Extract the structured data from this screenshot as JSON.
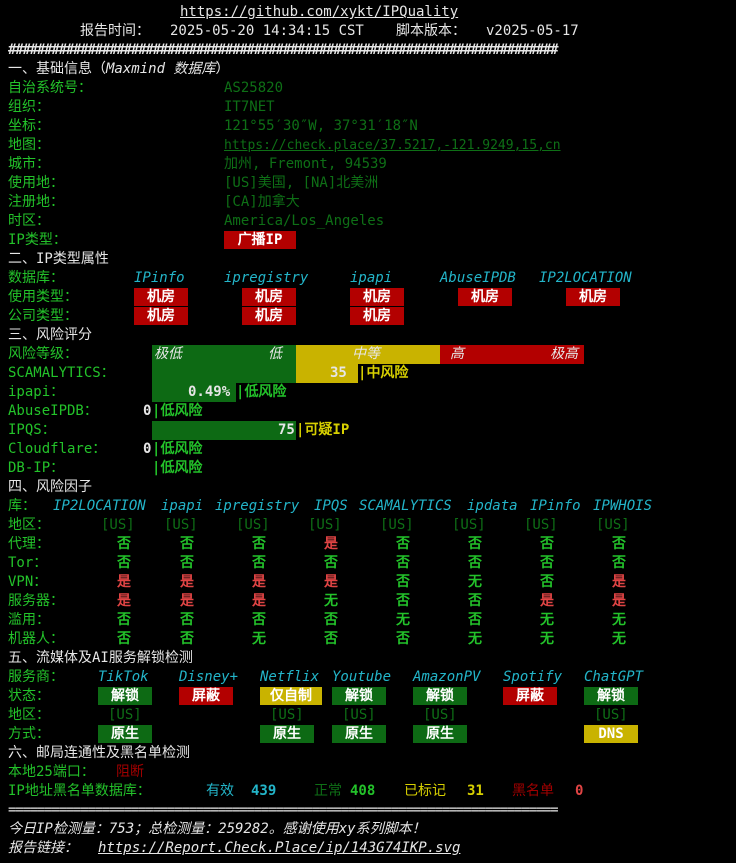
{
  "header": {
    "url": "https://github.com/xykt/IPQuality",
    "report_time_label": "报告时间：",
    "report_time": "2025-05-20 14:34:15 CST",
    "script_version_label": "脚本版本：",
    "script_version": "v2025-05-17",
    "separator": "############################################################################"
  },
  "basic": {
    "title": "一、基础信息（",
    "title_source": "Maxmind 数据库",
    "title_end": "）",
    "asn_label": "自治系统号：",
    "asn": "AS25820",
    "org_label": "组织：",
    "org": "IT7NET",
    "coord_label": "坐标：",
    "coord": "121°55′30″W, 37°31′18″N",
    "map_label": "地图：",
    "map": "https://check.place/37.5217,-121.9249,15,cn",
    "city_label": "城市：",
    "city": "加州, Fremont, 94539",
    "usage_loc_label": "使用地：",
    "usage_loc": "[US]美国, [NA]北美洲",
    "reg_loc_label": "注册地：",
    "reg_loc": "[CA]加拿大",
    "tz_label": "时区：",
    "tz": "America/Los_Angeles",
    "iptype_label": "IP类型：",
    "iptype": "广播IP"
  },
  "iptype": {
    "title": "二、IP类型属性",
    "db_label": "数据库：",
    "dbs": [
      "IPinfo",
      "ipregistry",
      "ipapi",
      "AbuseIPDB",
      "IP2LOCATION"
    ],
    "usage_label": "使用类型：",
    "usage": [
      "机房",
      "机房",
      "机房",
      "机房",
      "机房"
    ],
    "company_label": "公司类型：",
    "company": [
      "机房",
      "机房",
      "机房"
    ]
  },
  "risk": {
    "title": "三、风险评分",
    "level_label": "风险等级：",
    "levels": [
      "极低",
      "低",
      "中等",
      "高",
      "极高"
    ],
    "scam_label": "SCAMALYTICS：",
    "scam_score": "35",
    "scam_text": "中风险",
    "scam_pct": 35,
    "ipapi_label": "ipapi：",
    "ipapi_score": "0.49%",
    "ipapi_text": "低风险",
    "abuse_label": "AbuseIPDB：",
    "abuse_score": "0",
    "abuse_text": "低风险",
    "ipqs_label": "IPQS：",
    "ipqs_score": "75",
    "ipqs_text": "可疑IP",
    "ipqs_pct": 75,
    "cf_label": "Cloudflare：",
    "cf_score": "0",
    "cf_text": "低风险",
    "dbip_label": "DB-IP：",
    "dbip_text": "低风险"
  },
  "factors": {
    "title": "四、风险因子",
    "lib_label": "库：",
    "cols": [
      "IP2LOCATION",
      "ipapi",
      "ipregistry",
      "IPQS",
      "SCAMALYTICS",
      "ipdata",
      "IPinfo",
      "IPWHOIS"
    ],
    "rows": [
      {
        "label": "地区：",
        "values": [
          "[US]",
          "[US]",
          "[US]",
          "[US]",
          "[US]",
          "[US]",
          "[US]",
          "[US]"
        ]
      },
      {
        "label": "代理：",
        "values": [
          "否",
          "否",
          "否",
          "是",
          "否",
          "否",
          "否",
          "否"
        ]
      },
      {
        "label": "Tor：",
        "values": [
          "否",
          "否",
          "否",
          "否",
          "否",
          "否",
          "否",
          "否"
        ]
      },
      {
        "label": "VPN：",
        "values": [
          "是",
          "是",
          "是",
          "是",
          "否",
          "无",
          "否",
          "是"
        ]
      },
      {
        "label": "服务器：",
        "values": [
          "是",
          "是",
          "是",
          "无",
          "否",
          "否",
          "是",
          "是"
        ]
      },
      {
        "label": "滥用：",
        "values": [
          "否",
          "否",
          "否",
          "否",
          "无",
          "否",
          "无",
          "无"
        ]
      },
      {
        "label": "机器人：",
        "values": [
          "否",
          "否",
          "无",
          "否",
          "否",
          "无",
          "无",
          "无"
        ]
      }
    ]
  },
  "streaming": {
    "title": "五、流媒体及AI服务解锁检测",
    "provider_label": "服务商：",
    "providers": [
      "TikTok",
      "Disney+",
      "Netflix",
      "Youtube",
      "AmazonPV",
      "Spotify",
      "ChatGPT"
    ],
    "status_label": "状态：",
    "status": [
      "解锁",
      "屏蔽",
      "仅自制",
      "解锁",
      "解锁",
      "屏蔽",
      "解锁"
    ],
    "region_label": "地区：",
    "region": [
      "[US]",
      "",
      "[US]",
      "[US]",
      "[US]",
      "",
      "[US]"
    ],
    "method_label": "方式：",
    "method": [
      "原生",
      "",
      "原生",
      "原生",
      "原生",
      "",
      "DNS"
    ]
  },
  "mail": {
    "title": "六、邮局连通性及黑名单检测",
    "port_label": "本地25端口：",
    "port_value": "阻断",
    "bl_label": "IP地址黑名单数据库：",
    "valid_label": "有效",
    "valid": "439",
    "normal_label": "正常",
    "normal": "408",
    "marked_label": "已标记",
    "marked": "31",
    "black_label": "黑名单",
    "black": "0",
    "separator": "============================================================================"
  },
  "footer": {
    "stats": "今日IP检测量：753；总检测量：259282。感谢使用xy系列脚本！",
    "report_label": "报告链接：",
    "report_link": "https://Report.Check.Place/ip/143G74IKP.svg"
  },
  "colors": {
    "green": "#0d6a14",
    "red": "#b30000",
    "yellow": "#c9b300",
    "text_green": "#23c22a",
    "cyan": "#23b5c9"
  }
}
